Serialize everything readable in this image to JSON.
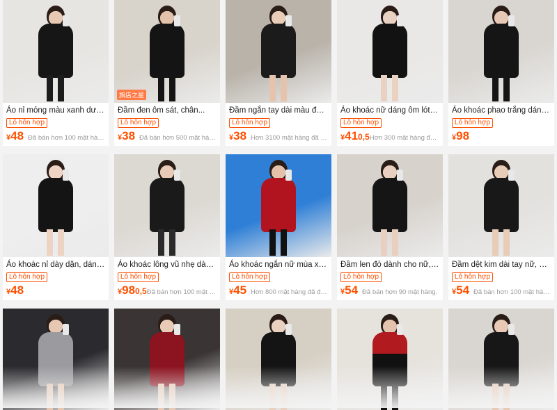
{
  "products": [
    {
      "title": "Áo nỉ mỏng màu xanh dương d...",
      "badge": "Lô hỗn hợp",
      "currency": "¥",
      "price": "48",
      "decimal": "",
      "sold": "Đã bán hơn 100 mặt hàng.",
      "bg": "#e7e5e1",
      "dress": "#161616",
      "skin": "#e7c9b4",
      "leg": "#1c1c1c"
    },
    {
      "title": "Đầm đen ôm sát, chân...",
      "badge": "Lô hỗn hợp",
      "currency": "¥",
      "price": "38",
      "decimal": "",
      "sold": "Đã bán hơn 500 mặt hàng.",
      "bg": "#d8d3cb",
      "dress": "#141414",
      "skin": "#e3c2ab",
      "leg": "#141414",
      "shop_tag": "旗店之星"
    },
    {
      "title": "Đầm ngắn tay dài màu đen tha...",
      "badge": "Lô hỗn hợp",
      "currency": "¥",
      "price": "38",
      "decimal": "",
      "sold": "Hơn 3100 mặt hàng đã được bán.",
      "bg": "#b9b3aa",
      "dress": "#1b1b1b",
      "skin": "#e9cdb9",
      "leg": "#e6c3ad"
    },
    {
      "title": "Áo khoác nữ dáng ôm lót lông c...",
      "badge": "Lô hỗn hợp",
      "currency": "¥",
      "price": "41",
      "decimal": "0,5",
      "sold": "Hơn 300 mặt hàng đã được bán.",
      "bg": "#e9e8e6",
      "dress": "#121212",
      "skin": "#ead2c2",
      "leg": "#ead2c2"
    },
    {
      "title": "Áo khoác phao trắng dáng ôm ...",
      "badge": "Lô hỗn hợp",
      "currency": "¥",
      "price": "98",
      "decimal": "",
      "sold": "",
      "bg": "#d9d6d1",
      "dress": "#151515",
      "skin": "#e6c8b4",
      "leg": "#151515"
    },
    {
      "title": "Áo khoác nỉ dày dặn, dáng ôm ...",
      "badge": "Lô hỗn hợp",
      "currency": "¥",
      "price": "48",
      "decimal": "",
      "sold": "",
      "bg": "#eeeeee",
      "dress": "#141414",
      "skin": "#ecd3c3",
      "leg": "#ecd3c3"
    },
    {
      "title": "Áo khoác lông vũ nhẹ dành cho...",
      "badge": "Lô hỗn hợp",
      "currency": "¥",
      "price": "98",
      "decimal": "0,5",
      "sold": "Đã bán hơn 100 mặt hàng.",
      "bg": "#dcd8d2",
      "dress": "#1a1a1a",
      "skin": "#e8cbb7",
      "leg": "#2a2a2a"
    },
    {
      "title": "Áo khoác ngắn nữ mùa xuân 20...",
      "badge": "Lô hỗn hợp",
      "currency": "¥",
      "price": "45",
      "decimal": "",
      "sold": "Hơn 800 mặt hàng đã được bán.",
      "bg": "#2f7fd6",
      "dress": "#b2141f",
      "skin": "#e4c2aa",
      "leg": "#111111"
    },
    {
      "title": "Đầm len đỏ dành cho nữ, hoàn ...",
      "badge": "Lô hỗn hợp",
      "currency": "¥",
      "price": "54",
      "decimal": "",
      "sold": "Đã bán hơn 90 mặt hàng.",
      "bg": "#d7d2cc",
      "dress": "#151515",
      "skin": "#e9cfbf",
      "leg": "#e9cfbf"
    },
    {
      "title": "Đầm dệt kim dài tay nữ, kiểu d...",
      "badge": "Lô hỗn hợp",
      "currency": "¥",
      "price": "54",
      "decimal": "",
      "sold": "Đã bán hơn 100 mặt hàng.",
      "bg": "#e3e1de",
      "dress": "#181818",
      "skin": "#e7ccb8",
      "leg": "#e7ccb8"
    },
    {
      "title": "",
      "badge": "",
      "currency": "",
      "price": "",
      "decimal": "",
      "sold": "",
      "bg": "#2b2b2f",
      "dress": "#9b9b9f",
      "skin": "#e6c7b2",
      "leg": "#e6c7b2"
    },
    {
      "title": "",
      "badge": "",
      "currency": "",
      "price": "",
      "decimal": "",
      "sold": "",
      "bg": "#3a3434",
      "dress": "#8c1320",
      "skin": "#e8cbb6",
      "leg": "#e8cbb6"
    },
    {
      "title": "",
      "badge": "",
      "currency": "",
      "price": "",
      "decimal": "",
      "sold": "",
      "bg": "#d6cfc3",
      "dress": "#141414",
      "skin": "#ead0bf",
      "leg": "#ead0bf"
    },
    {
      "title": "",
      "badge": "",
      "currency": "",
      "price": "",
      "decimal": "",
      "sold": "",
      "bg": "#e6e2dc",
      "dress": "#111111",
      "skin": "#e3c3ad",
      "leg": "#111111",
      "jacket": "#b11a1f"
    },
    {
      "title": "",
      "badge": "",
      "currency": "",
      "price": "",
      "decimal": "",
      "sold": "",
      "bg": "#d9d5d0",
      "dress": "#171717",
      "skin": "#e7c9b5",
      "leg": "#e7c9b5"
    }
  ]
}
